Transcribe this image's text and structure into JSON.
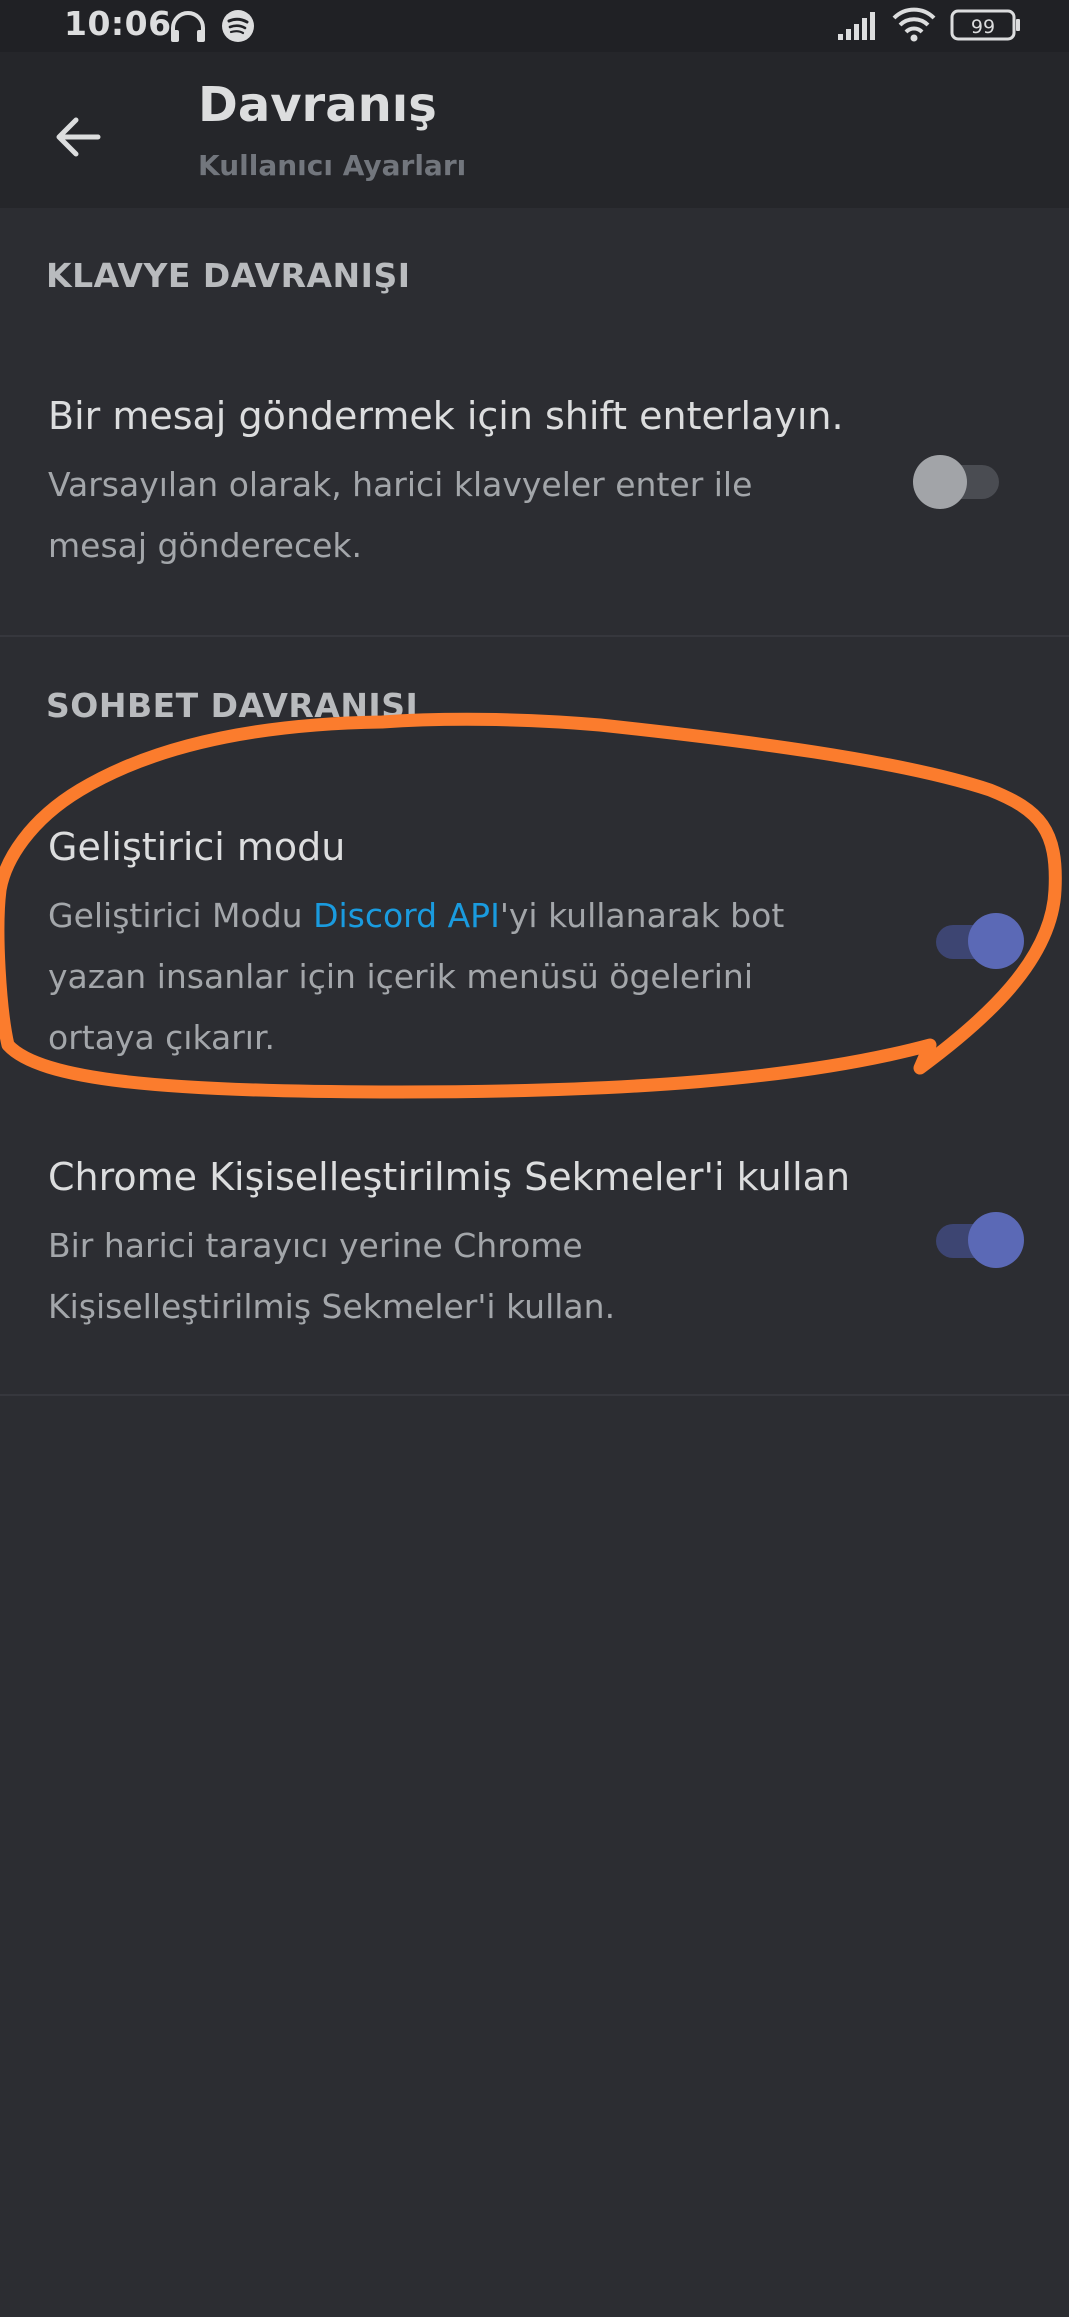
{
  "status_bar": {
    "time": "10:06",
    "battery": "99",
    "icons": [
      "headphones-icon",
      "spotify-icon",
      "signal-icon",
      "wifi-icon",
      "battery-icon"
    ]
  },
  "header": {
    "title": "Davranış",
    "subtitle": "Kullanıcı Ayarları",
    "back_icon": "arrow-left-icon"
  },
  "sections": [
    {
      "header": "KLAVYE DAVRANIŞI",
      "settings": [
        {
          "title": "Bir mesaj göndermek için shift enterlayın.",
          "description": "Varsayılan olarak, harici klavyeler enter ile mesaj gönderecek.",
          "enabled": false
        }
      ]
    },
    {
      "header": "SOHBET DAVRANIŞI",
      "settings": [
        {
          "title": "Geliştirici modu",
          "description_before": "Geliştirici Modu ",
          "description_link": "Discord API",
          "description_after": "'yi kullanarak bot yazan insanlar için içerik menüsü ögelerini ortaya çıkarır.",
          "enabled": true
        },
        {
          "title": "Chrome Kişiselleştirilmiş Sekmeler'i kullan",
          "description": "Bir harici tarayıcı yerine Chrome Kişiselleştirilmiş Sekmeler'i kullan.",
          "enabled": true
        }
      ]
    }
  ],
  "colors": {
    "background": "#2c2d32",
    "app_bar": "#25262a",
    "toggle_on_knob": "#5b69b6",
    "toggle_off_knob": "#a2a4a8",
    "link": "#1a9bdf",
    "annotation": "#fb7c2d"
  }
}
